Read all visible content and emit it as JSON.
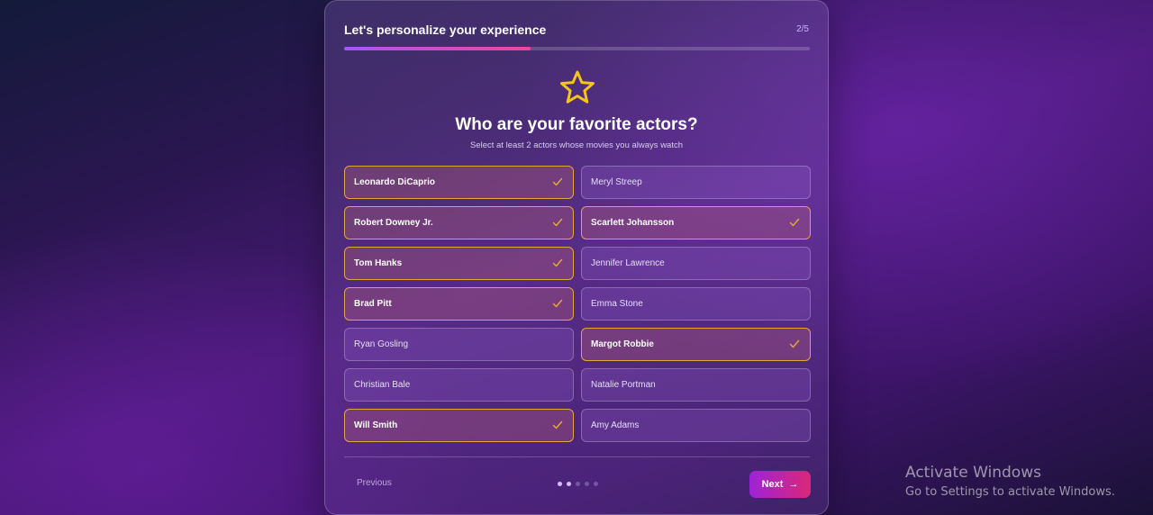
{
  "header": {
    "title": "Let's personalize your experience",
    "step": "2/5"
  },
  "progress": {
    "fraction": 0.4
  },
  "question": {
    "icon": "star-icon",
    "title": "Who are your favorite actors?",
    "subtitle": "Select at least 2 actors whose movies you always watch"
  },
  "actors": [
    {
      "name": "Leonardo DiCaprio",
      "selected": true
    },
    {
      "name": "Meryl Streep",
      "selected": false
    },
    {
      "name": "Robert Downey Jr.",
      "selected": true
    },
    {
      "name": "Scarlett Johansson",
      "selected": true
    },
    {
      "name": "Tom Hanks",
      "selected": true
    },
    {
      "name": "Jennifer Lawrence",
      "selected": false
    },
    {
      "name": "Brad Pitt",
      "selected": true
    },
    {
      "name": "Emma Stone",
      "selected": false
    },
    {
      "name": "Ryan Gosling",
      "selected": false
    },
    {
      "name": "Margot Robbie",
      "selected": true
    },
    {
      "name": "Christian Bale",
      "selected": false
    },
    {
      "name": "Natalie Portman",
      "selected": false
    },
    {
      "name": "Will Smith",
      "selected": true
    },
    {
      "name": "Amy Adams",
      "selected": false
    }
  ],
  "footer": {
    "previous_label": "Previous",
    "next_label": "Next",
    "next_icon": "→",
    "total_steps": 5,
    "current_step": 2
  },
  "watermark": {
    "title": "Activate Windows",
    "subtitle": "Go to Settings to activate Windows."
  },
  "colors": {
    "accent_start": "#a855f7",
    "accent_end": "#ec4899",
    "selected_border": "#e0a838",
    "star": "#f5c518"
  }
}
